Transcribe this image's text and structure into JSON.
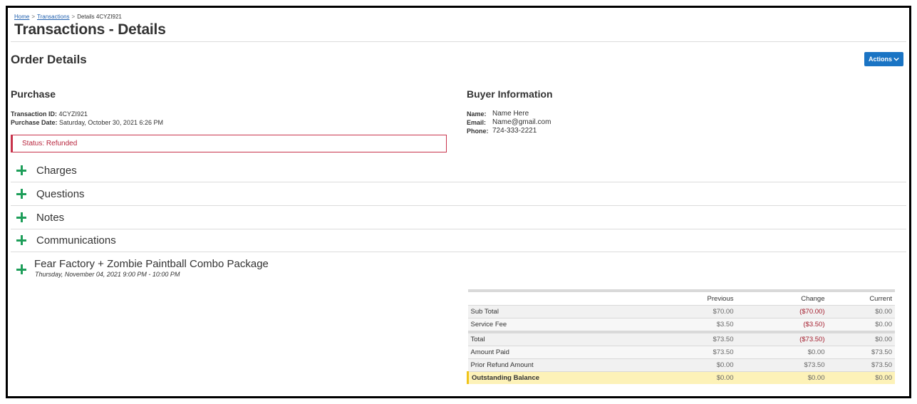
{
  "breadcrumb": {
    "home": "Home",
    "sep1": ">",
    "transactions": "Transactions",
    "sep2": ">",
    "current": "Details 4CYZI921"
  },
  "page_title": "Transactions - Details",
  "order_title": "Order Details",
  "actions_label": "Actions",
  "purchase": {
    "heading": "Purchase",
    "id_label": "Transaction ID:",
    "id_value": "4CYZI921",
    "date_label": "Purchase Date:",
    "date_value": "Saturday, October 30, 2021 6:26 PM",
    "status": "Status: Refunded"
  },
  "buyer": {
    "heading": "Buyer Information",
    "name_label": "Name:",
    "name_value": "Name Here",
    "email_label": "Email:",
    "email_value": "Name@gmail.com",
    "phone_label": "Phone:",
    "phone_value": "724-333-2221"
  },
  "sections": [
    "Charges",
    "Questions",
    "Notes",
    "Communications"
  ],
  "event": {
    "name": "Fear Factory + Zombie Paintball Combo Package",
    "date": "Thursday, November 04, 2021 9:00 PM - 10:00 PM"
  },
  "totals": {
    "headers": [
      "",
      "Previous",
      "Change",
      "Current"
    ],
    "rows": [
      {
        "label": "Sub Total",
        "previous": "$70.00",
        "change": "($70.00)",
        "current": "$0.00"
      },
      {
        "label": "Service Fee",
        "previous": "$3.50",
        "change": "($3.50)",
        "current": "$0.00"
      },
      {
        "label": "Total",
        "previous": "$73.50",
        "change": "($73.50)",
        "current": "$0.00"
      },
      {
        "label": "Amount Paid",
        "previous": "$73.50",
        "change": "$0.00",
        "current": "$73.50"
      },
      {
        "label": "Prior Refund Amount",
        "previous": "$0.00",
        "change": "$73.50",
        "current": "$73.50"
      },
      {
        "label": "Outstanding Balance",
        "previous": "$0.00",
        "change": "$0.00",
        "current": "$0.00"
      }
    ]
  },
  "colors": {
    "accent": "#1a74c4",
    "plus": "#1e9e5a",
    "status": "#c8334b",
    "negative": "#a31c2c",
    "balance_bg": "#fdf2b8"
  }
}
